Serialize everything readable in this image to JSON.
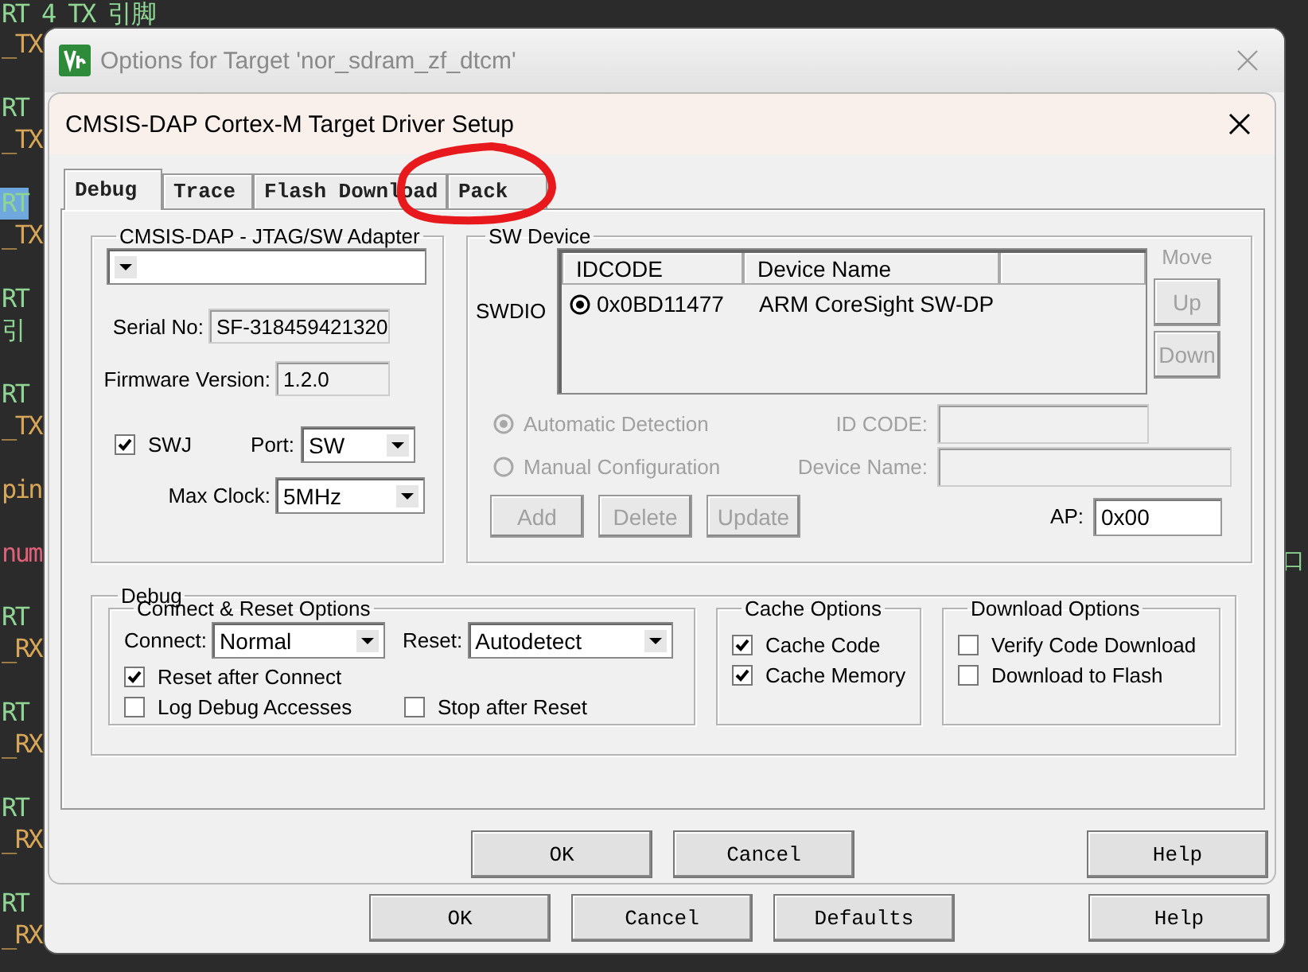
{
  "editor": {
    "blocks": [
      [
        {
          "text": "RT 4 TX 引脚",
          "kind": "macro",
          "selected": false
        },
        {
          "text": "_TX",
          "kind": "member",
          "selected": false
        }
      ],
      [
        {
          "text": "RT",
          "kind": "macro",
          "selected": false
        },
        {
          "text": "_TX",
          "kind": "member",
          "selected": false
        }
      ],
      [
        {
          "text": "RT",
          "kind": "macro",
          "selected": true
        },
        {
          "text": "_TX",
          "kind": "member",
          "selected": false
        }
      ],
      [
        {
          "text": "RT",
          "kind": "macro",
          "selected": false
        },
        {
          "text": "引",
          "kind": "macro",
          "selected": false
        }
      ],
      [
        {
          "text": "RT",
          "kind": "macro",
          "selected": false
        },
        {
          "text": "_TX",
          "kind": "member",
          "selected": false
        }
      ],
      [
        {
          "text": "pin",
          "kind": "member",
          "selected": false
        }
      ],
      [
        {
          "text": "num",
          "kind": "type",
          "selected": false
        }
      ],
      [
        {
          "text": "RT",
          "kind": "macro",
          "selected": false
        },
        {
          "text": "_RX",
          "kind": "member",
          "selected": false
        }
      ],
      [
        {
          "text": "RT",
          "kind": "macro",
          "selected": false
        },
        {
          "text": "_RX",
          "kind": "member",
          "selected": false
        }
      ],
      [
        {
          "text": "RT",
          "kind": "macro",
          "selected": false
        },
        {
          "text": "_RX",
          "kind": "member",
          "selected": false
        }
      ],
      [
        {
          "text": "RT",
          "kind": "macro",
          "selected": false
        },
        {
          "text": "_RX",
          "kind": "member",
          "selected": false
        }
      ]
    ],
    "right_text": "口"
  },
  "outer_dialog": {
    "title": "Options for Target 'nor_sdram_zf_dtcm'",
    "buttons": [
      "OK",
      "Cancel",
      "Defaults",
      "Help"
    ]
  },
  "dialog": {
    "title": "CMSIS-DAP Cortex-M Target Driver Setup",
    "tabs": [
      {
        "label": "Debug",
        "selected": true
      },
      {
        "label": "Trace",
        "selected": false
      },
      {
        "label": "Flash Download",
        "selected": false
      },
      {
        "label": "Pack",
        "selected": false
      }
    ],
    "adapter": {
      "title": "CMSIS-DAP - JTAG/SW Adapter",
      "serial_label": "Serial No:",
      "serial": "SF-318459421320",
      "firmware_label": "Firmware Version:",
      "firmware": "1.2.0",
      "swj": {
        "label": "SWJ",
        "checked": true
      },
      "port_label": "Port:",
      "port": "SW",
      "clock_label": "Max Clock:",
      "clock": "5MHz"
    },
    "sw_device": {
      "title": "SW Device",
      "row_label": "SWDIO",
      "columns": [
        "IDCODE",
        "Device Name"
      ],
      "rows": [
        {
          "idcode": "0x0BD11477",
          "name": "ARM CoreSight SW-DP",
          "selected": true
        }
      ],
      "move_label": "Move",
      "move_buttons": [
        {
          "label": "Up",
          "disabled": true
        },
        {
          "label": "Down",
          "disabled": true
        }
      ],
      "detection": [
        {
          "label": "Automatic Detection",
          "selected": true,
          "disabled": true
        },
        {
          "label": "Manual Configuration",
          "selected": false,
          "disabled": true
        }
      ],
      "id_code_label": "ID CODE:",
      "device_name_label": "Device Name:",
      "actions": [
        {
          "label": "Add",
          "disabled": true
        },
        {
          "label": "Delete",
          "disabled": true
        },
        {
          "label": "Update",
          "disabled": true
        }
      ],
      "ap_label": "AP:",
      "ap": "0x00"
    },
    "debug": {
      "title": "Debug",
      "connect_reset": {
        "title": "Connect & Reset Options",
        "connect_label": "Connect:",
        "connect": "Normal",
        "reset_label": "Reset:",
        "reset": "Autodetect",
        "options": [
          {
            "label": "Reset after Connect",
            "checked": true
          },
          {
            "label": "Log Debug Accesses",
            "checked": false
          },
          {
            "label": "Stop after Reset",
            "checked": false
          }
        ]
      },
      "cache": {
        "title": "Cache Options",
        "options": [
          {
            "label": "Cache Code",
            "checked": true
          },
          {
            "label": "Cache Memory",
            "checked": true
          }
        ]
      },
      "download": {
        "title": "Download Options",
        "options": [
          {
            "label": "Verify Code Download",
            "checked": false
          },
          {
            "label": "Download to Flash",
            "checked": false
          }
        ]
      }
    },
    "buttons": [
      "OK",
      "Cancel",
      "Help"
    ]
  }
}
